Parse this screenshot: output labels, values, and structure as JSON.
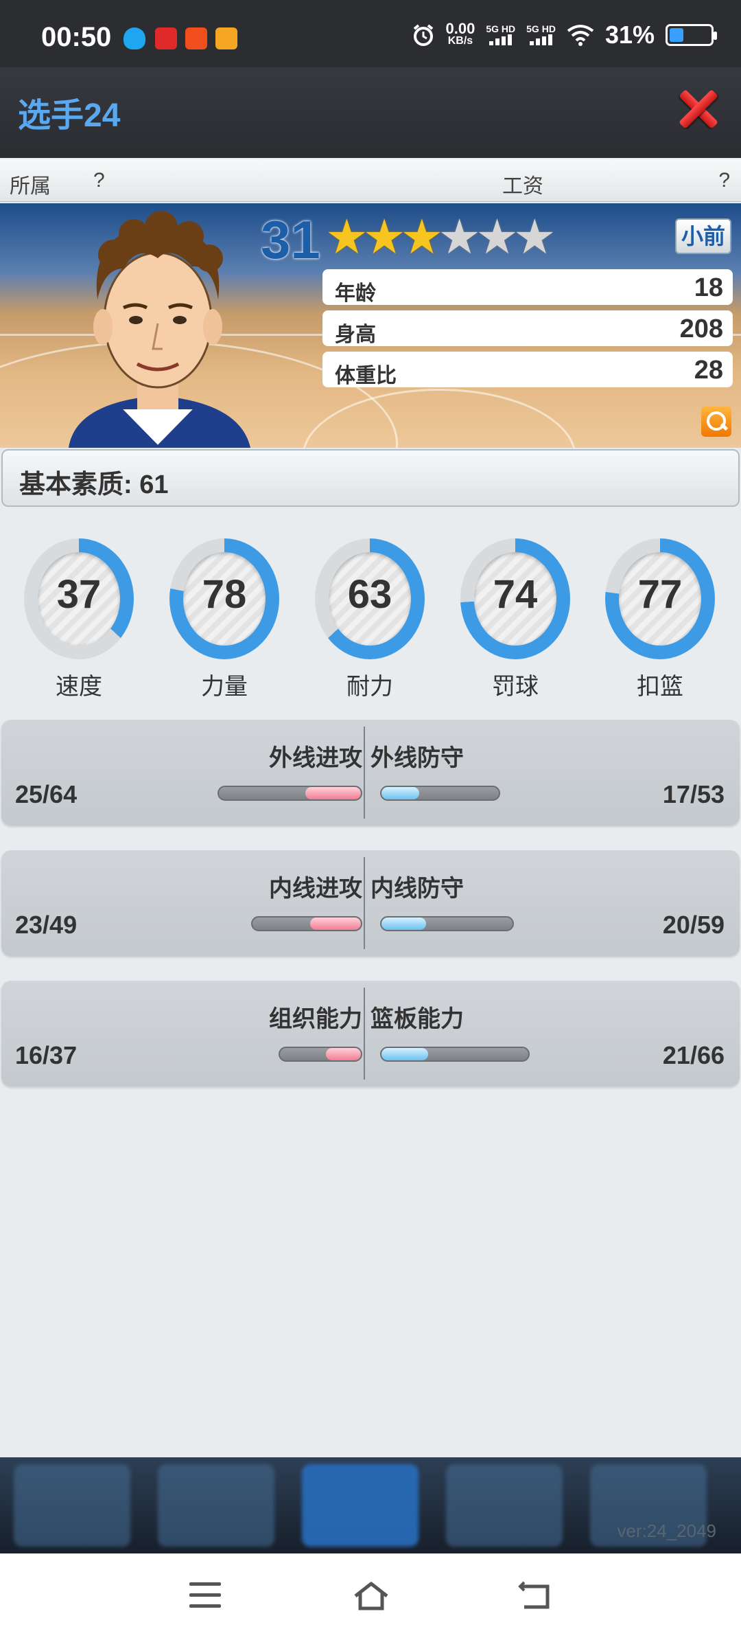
{
  "status_bar": {
    "time": "00:50",
    "net_speed": "0.00",
    "net_unit": "KB/s",
    "sig1": "5G HD",
    "sig2": "5G HD",
    "battery": "31%",
    "icons": [
      "qq-icon",
      "qidian-icon",
      "taobao-icon",
      "weibo-icon",
      "alarm-icon",
      "wifi-icon",
      "battery-icon"
    ]
  },
  "header": {
    "title": "选手24",
    "close_icon": "close-icon"
  },
  "info_row": {
    "team_label": "所属",
    "team_value": "?",
    "salary_label": "工资",
    "salary_value": "?"
  },
  "player": {
    "overall": "31",
    "stars_filled": 3,
    "stars_total": 6,
    "position": "小前",
    "attributes": [
      {
        "label": "年龄",
        "value": "18"
      },
      {
        "label": "身高",
        "value": "208"
      },
      {
        "label": "体重比",
        "value": "28"
      }
    ]
  },
  "base": {
    "text": "基本素质: 61"
  },
  "gauges": [
    {
      "label": "速度",
      "value": "37"
    },
    {
      "label": "力量",
      "value": "78"
    },
    {
      "label": "耐力",
      "value": "63"
    },
    {
      "label": "罚球",
      "value": "74"
    },
    {
      "label": "扣篮",
      "value": "77"
    }
  ],
  "skills": [
    {
      "left_title": "外线进攻",
      "left_value": "25/64",
      "left_current": 25,
      "left_max": 64,
      "right_title": "外线防守",
      "right_value": "17/53",
      "right_current": 17,
      "right_max": 53
    },
    {
      "left_title": "内线进攻",
      "left_value": "23/49",
      "left_current": 23,
      "left_max": 49,
      "right_title": "内线防守",
      "right_value": "20/59",
      "right_current": 20,
      "right_max": 59
    },
    {
      "left_title": "组织能力",
      "left_value": "16/37",
      "left_current": 16,
      "left_max": 37,
      "right_title": "篮板能力",
      "right_value": "21/66",
      "right_current": 21,
      "right_max": 66
    }
  ],
  "footer": {
    "version": "ver:24_2049"
  },
  "colors": {
    "accent_blue": "#5aa9f0",
    "gauge_blue": "#3d9be6",
    "bar_pink": "#f17d93",
    "bar_blue": "#6cc1f0",
    "close_red": "#d81f1f",
    "star_gold": "#f7c520"
  }
}
